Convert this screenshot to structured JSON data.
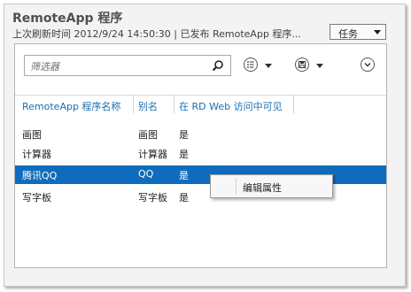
{
  "header": {
    "title": "RemoteApp 程序",
    "subtitle": "上次刷新时间 2012/9/24 14:50:30 | 已发布 RemoteApp 程序...",
    "tasks_label": "任务"
  },
  "toolbar": {
    "filter_placeholder": "筛选器",
    "icons": [
      "search-icon",
      "list-options-icon",
      "save-icon",
      "expand-icon"
    ]
  },
  "table": {
    "columns": [
      "RemoteApp 程序名称",
      "别名",
      "在 RD Web 访问中可见"
    ],
    "rows": [
      {
        "name": "画图",
        "alias": "画图",
        "visible": "是",
        "selected": false
      },
      {
        "name": "计算器",
        "alias": "计算器",
        "visible": "是",
        "selected": false
      },
      {
        "name": "腾讯QQ",
        "alias": "QQ",
        "visible": "是",
        "selected": true
      },
      {
        "name": "写字板",
        "alias": "写字板",
        "visible": "是",
        "selected": false
      }
    ]
  },
  "context_menu": {
    "items": [
      "编辑属性"
    ]
  },
  "colors": {
    "accent": "#1a6fb0",
    "selection": "#0f6cbd"
  }
}
